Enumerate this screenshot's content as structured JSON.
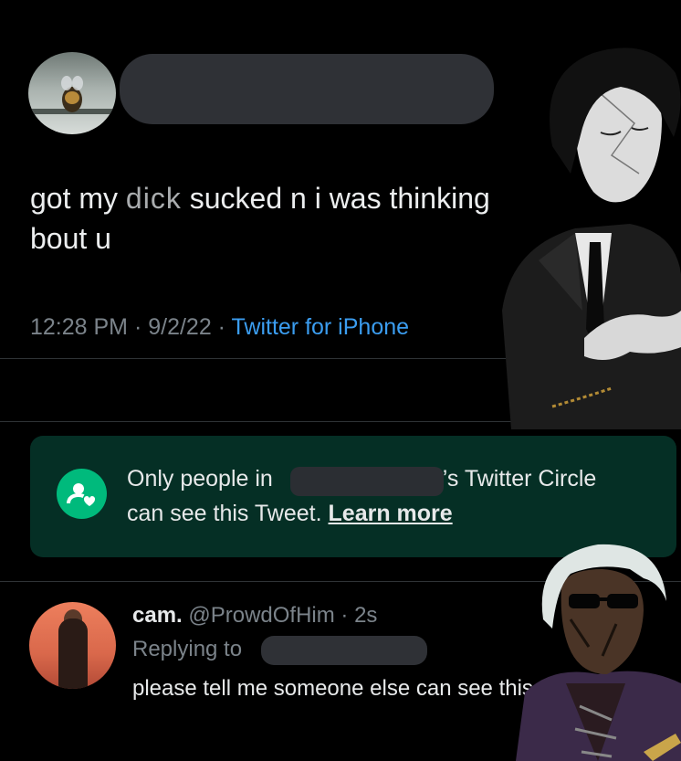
{
  "tweet": {
    "text_part1": "got my ",
    "text_smudge": "dick",
    "text_part2": " sucked n i was thinking",
    "text_line2": "bout u",
    "time": "12:28 PM · 9/2/22 · ",
    "source": "Twitter for iPhone"
  },
  "circle_notice": {
    "line1_pre": "Only people in",
    "line1_post": "e’s Twitter Circle",
    "line2": "can see this Tweet.",
    "learn_more": "Learn more"
  },
  "reply": {
    "name": "cam.",
    "handle": "@ProwdOfHim · 2s",
    "replying_to": "Replying to",
    "text": "please tell me someone else can see this"
  },
  "icons": [
    "reply-icon",
    "retweet-icon",
    "like-icon",
    "share-icon",
    "twitter-circle-icon"
  ],
  "colors": {
    "background": "#000000",
    "link": "#3b9df0",
    "circle_bg": "#052f25",
    "circle_icon": "#00ba7c",
    "muted": "#7b838a"
  }
}
